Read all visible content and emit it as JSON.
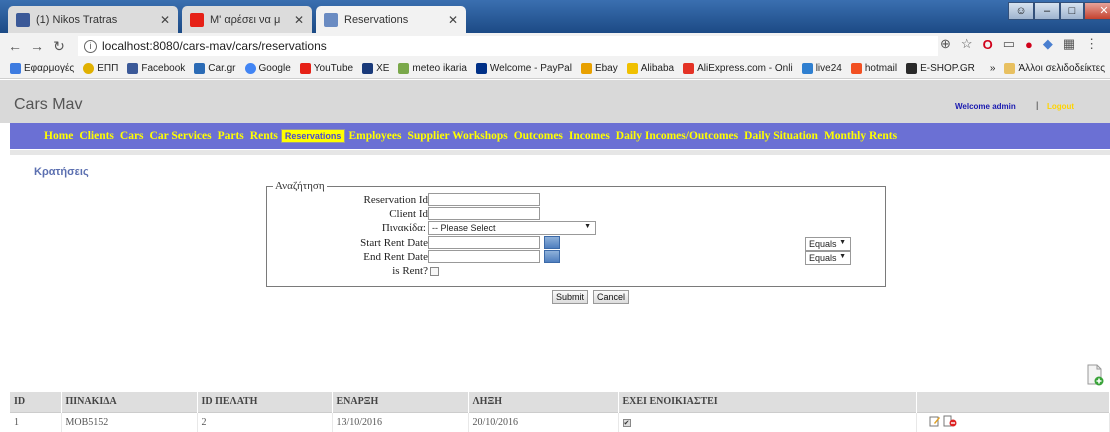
{
  "browser": {
    "tabs": [
      {
        "label": "(1) Nikos Tratras",
        "icon": "facebook-icon",
        "color": "#3b5998"
      },
      {
        "label": "Μ' αρέσει να μη λέω",
        "icon": "youtube-icon",
        "color": "#e62117"
      },
      {
        "label": "Reservations",
        "icon": "page-icon",
        "color": "#6a8bc2"
      }
    ],
    "url": "localhost:8080/cars-mav/cars/reservations",
    "bookmarks": [
      "Εφαρμογές",
      "ΕΠΠ",
      "Facebook",
      "Car.gr",
      "Google",
      "YouTube",
      "XE",
      "meteo ikaria",
      "Welcome - PayPal",
      "Ebay",
      "Alibaba",
      "AliExpress.com - Onli",
      "live24",
      "hotmail",
      "E-SHOP.GR"
    ],
    "other_bookmarks": "Άλλοι σελιδοδείκτες"
  },
  "app": {
    "brand": "Cars Mav",
    "welcome": "Welcome admin",
    "divider": "|",
    "logout": "Logout",
    "menu": [
      "Home",
      "Clients",
      "Cars",
      "Car Services",
      "Parts",
      "Rents",
      "Reservations",
      "Employees",
      "Supplier Workshops",
      "Outcomes",
      "Incomes",
      "Daily Incomes/Outcomes",
      "Daily Situation",
      "Monthly Rents"
    ],
    "menu_selected": "Reservations"
  },
  "page_title": "Κρατήσεις",
  "search": {
    "legend": "Αναζήτηση",
    "reservation_id_label": "Reservation Id",
    "client_id_label": "Client Id",
    "plate_label": "Πινακίδα:",
    "plate_value": "-- Please Select",
    "start_label": "Start Rent Date",
    "end_label": "End Rent Date",
    "is_rent_label": "is Rent?",
    "start_op": "Equals",
    "end_op": "Equals",
    "submit": "Submit",
    "cancel": "Cancel"
  },
  "table": {
    "headers": [
      "ID",
      "ΠΙΝΑΚΙΔΑ",
      "ID ΠΕΛΑΤΗ",
      "ΕΝΑΡΞΗ",
      "ΛΗΞΗ",
      "ΕΧΕΙ ΕΝΟΙΚΙΑΣΤΕΙ",
      ""
    ],
    "rows": [
      {
        "id": "1",
        "plate": "MOB5152",
        "client_id": "2",
        "start": "13/10/2016",
        "end": "20/10/2016",
        "rented": true
      }
    ]
  }
}
